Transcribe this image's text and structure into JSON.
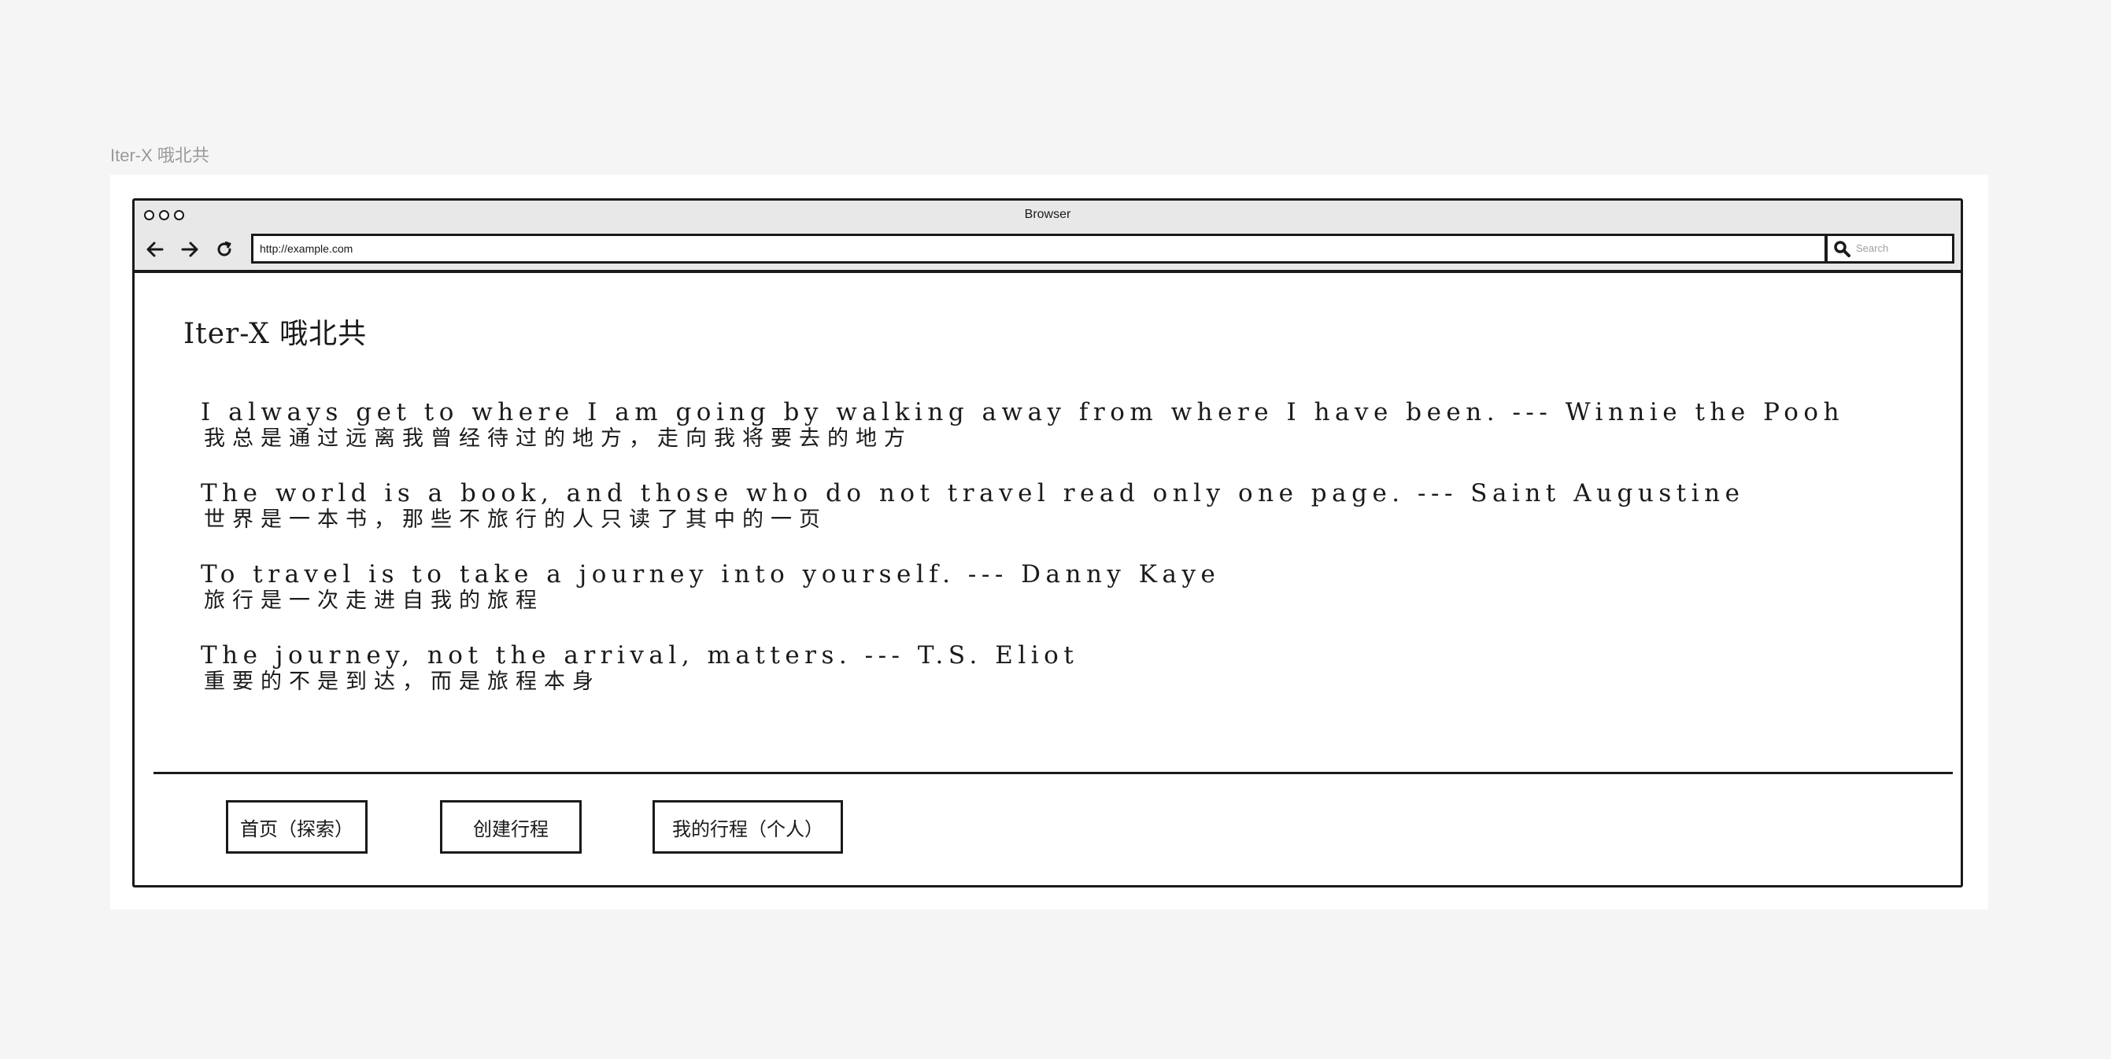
{
  "canvas": {
    "label": "Iter-X 哦北共"
  },
  "browser": {
    "title": "Browser",
    "url": "http://example.com",
    "search_placeholder": "Search",
    "icons": [
      "back-arrow-icon",
      "forward-arrow-icon",
      "reload-icon",
      "search-icon"
    ]
  },
  "page": {
    "heading": "Iter-X 哦北共",
    "quotes": [
      {
        "en": "I always get to where I am going by walking away from where I have been. --- Winnie the Pooh",
        "zh": "我总是通过远离我曾经待过的地方，走向我将要去的地方"
      },
      {
        "en": "The world is a book, and those who do not travel read only one page. --- Saint Augustine",
        "zh": "世界是一本书，那些不旅行的人只读了其中的一页"
      },
      {
        "en": "To travel is to take a journey into yourself. --- Danny Kaye",
        "zh": "旅行是一次走进自我的旅程"
      },
      {
        "en": "The journey, not the arrival, matters. --- T.S. Eliot",
        "zh": "重要的不是到达，而是旅程本身"
      }
    ],
    "nav": {
      "home": "首页（探索）",
      "create": "创建行程",
      "mine": "我的行程（个人）"
    }
  }
}
